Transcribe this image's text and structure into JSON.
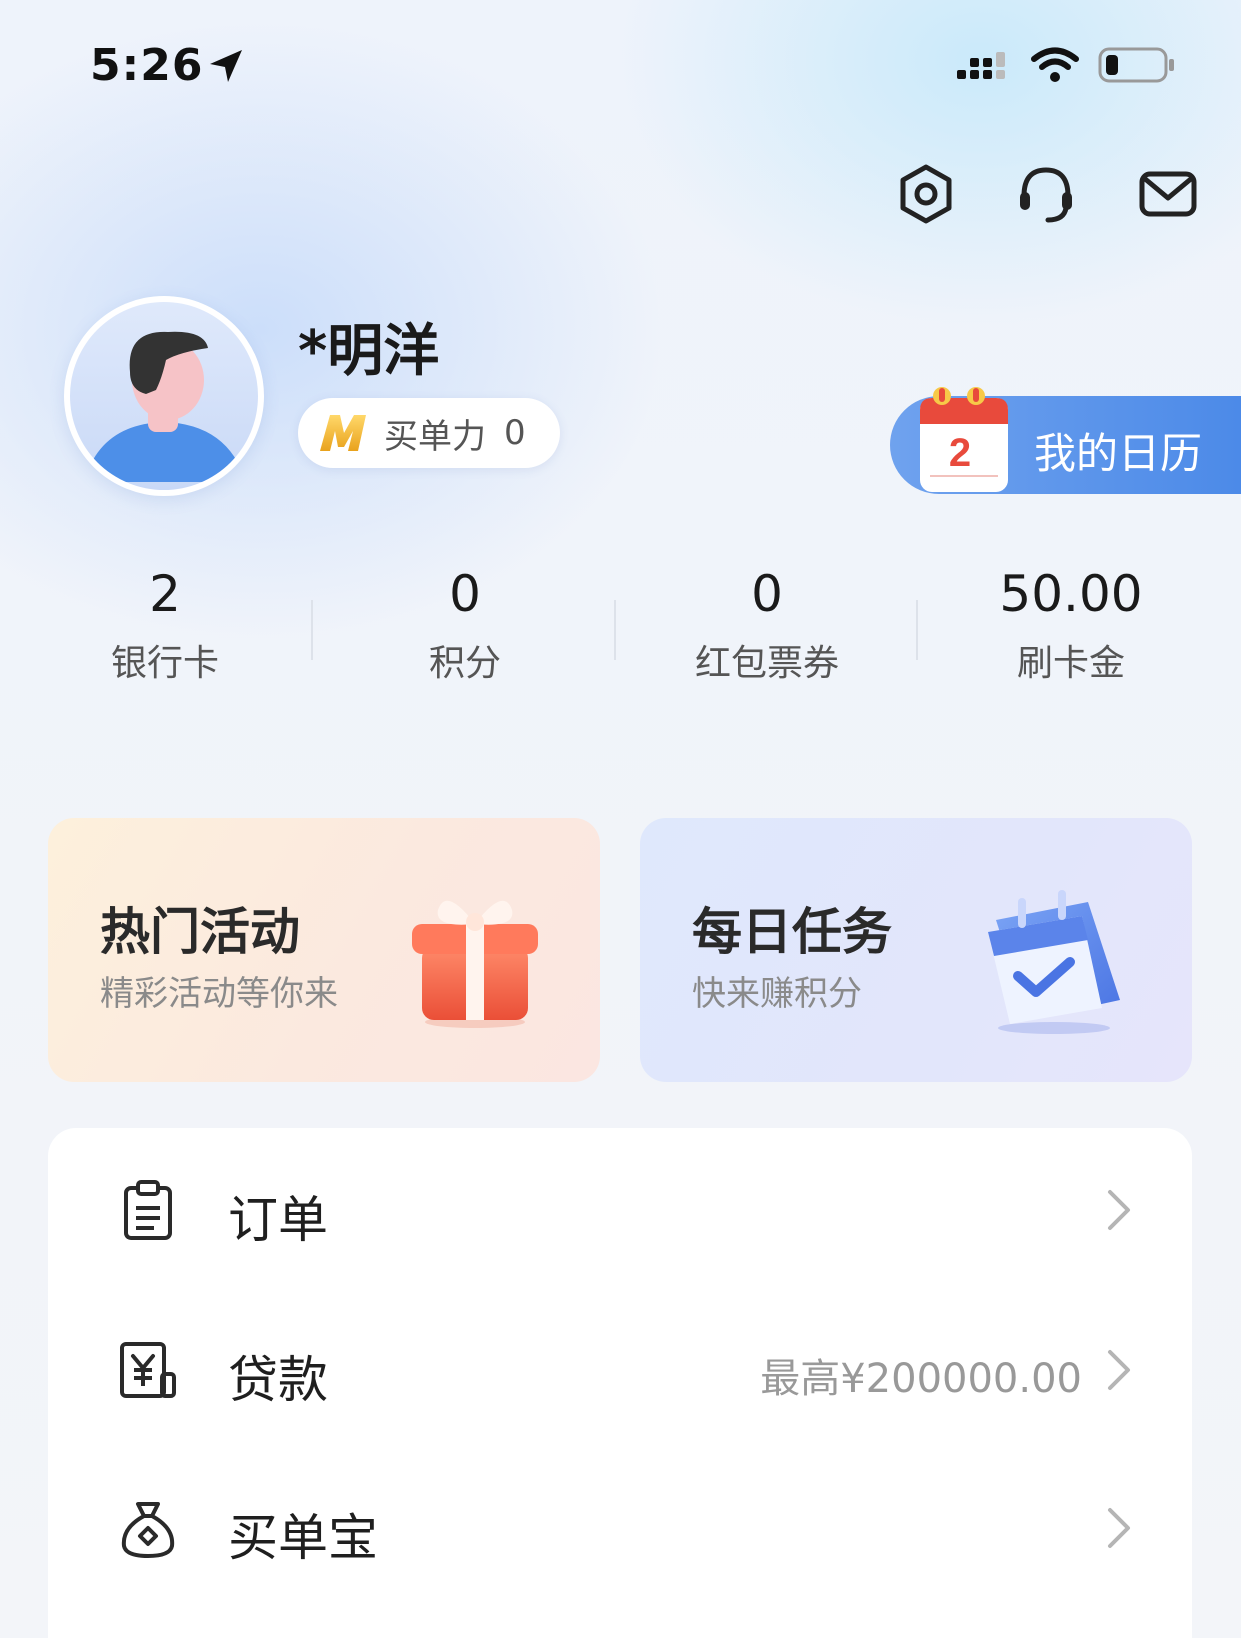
{
  "status_bar": {
    "time": "5:26",
    "icons": [
      "location-arrow-icon",
      "signal-icon",
      "wifi-icon",
      "battery-icon"
    ]
  },
  "header": {
    "icons": [
      "settings-icon",
      "headset-icon",
      "mail-icon"
    ]
  },
  "profile": {
    "name": "*明洋",
    "power_label": "买单力",
    "power_value": "0"
  },
  "calendar_button": {
    "label": "我的日历",
    "day": "2"
  },
  "stats": [
    {
      "value": "2",
      "label": "银行卡"
    },
    {
      "value": "0",
      "label": "积分"
    },
    {
      "value": "0",
      "label": "红包票券"
    },
    {
      "value": "50.00",
      "label": "刷卡金"
    }
  ],
  "cards": [
    {
      "title": "热门活动",
      "subtitle": "精彩活动等你来",
      "icon": "gift-icon"
    },
    {
      "title": "每日任务",
      "subtitle": "快来赚积分",
      "icon": "calendar-check-icon"
    }
  ],
  "menu": [
    {
      "label": "订单",
      "sub": "",
      "icon": "clipboard-icon"
    },
    {
      "label": "贷款",
      "sub": "最高¥200000.00",
      "icon": "yen-card-icon"
    },
    {
      "label": "买单宝",
      "sub": "",
      "icon": "money-bag-icon"
    }
  ],
  "colors": {
    "accent_blue": "#4c8ae8",
    "calendar_red": "#e84a3c",
    "gold": "#f2b233"
  }
}
